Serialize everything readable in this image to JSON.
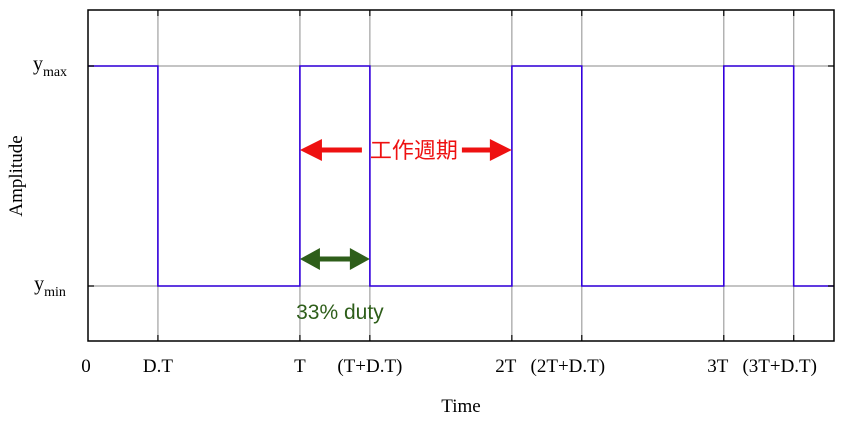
{
  "chart_data": {
    "type": "line",
    "xlabel": "Time",
    "ylabel": "Amplitude",
    "x_ticks": [
      "0",
      "D.T",
      "T",
      "(T+D.T)",
      "2T",
      "(2T+D.T)",
      "3T",
      "(3T+D.T)"
    ],
    "y_ticks": [
      {
        "base": "y",
        "sub": "min"
      },
      {
        "base": "y",
        "sub": "max"
      }
    ],
    "period": 1,
    "duty": 0.33,
    "xlim": [
      0,
      3.52
    ],
    "levels": {
      "min": 0,
      "max": 1
    },
    "series": [
      {
        "x": [
          0,
          0.33,
          0.33,
          1,
          1,
          1.33,
          1.33,
          2,
          2,
          2.33,
          2.33,
          3,
          3,
          3.33,
          3.33,
          3.52
        ],
        "y": [
          1,
          1,
          0,
          0,
          1,
          1,
          0,
          0,
          1,
          1,
          0,
          0,
          1,
          1,
          0,
          0
        ]
      }
    ],
    "grid": true,
    "colors": {
      "signal": "#3300dd",
      "grid": "#a0a0a0",
      "period_arrow": "#ee1111",
      "duty_arrow": "#2e5e1a"
    },
    "annotations": {
      "period_label": "工作週期",
      "duty_label": "33% duty"
    }
  }
}
